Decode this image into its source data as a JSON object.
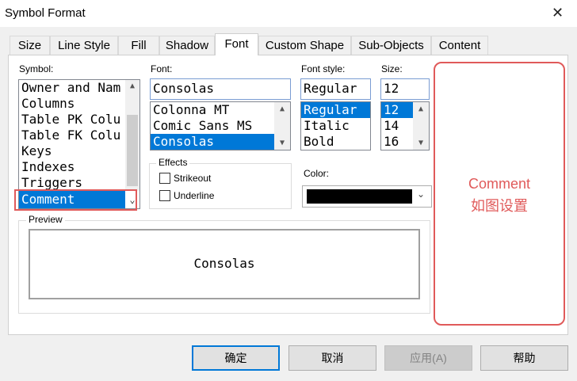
{
  "window": {
    "title": "Symbol Format",
    "close_glyph": "✕"
  },
  "tabs": [
    "Size",
    "Line Style",
    "Fill",
    "Shadow",
    "Font",
    "Custom Shape",
    "Sub-Objects",
    "Content"
  ],
  "symbol": {
    "label": "Symbol:",
    "items": [
      "Owner and Nam",
      "Columns",
      "Table PK Colu",
      "Table FK Colu",
      "Keys",
      "Indexes",
      "Triggers"
    ],
    "selected": "Comment"
  },
  "font": {
    "label": "Font:",
    "value": "Consolas",
    "items": [
      "Colonna MT",
      "Comic Sans MS",
      "Consolas"
    ]
  },
  "font_style": {
    "label": "Font style:",
    "value": "Regular",
    "items": [
      "Regular",
      "Italic",
      "Bold"
    ]
  },
  "size": {
    "label": "Size:",
    "value": "12",
    "items": [
      "12",
      "14",
      "16"
    ]
  },
  "effects": {
    "label": "Effects",
    "strikeout": "Strikeout",
    "underline": "Underline"
  },
  "color": {
    "label": "Color:",
    "value": "#000000"
  },
  "preview": {
    "label": "Preview",
    "text": "Consolas"
  },
  "annotation": {
    "line1": "Comment",
    "line2": "如图设置",
    "color": "#e05a5a"
  },
  "buttons": {
    "ok": "确定",
    "cancel": "取消",
    "apply": "应用(A)",
    "help": "帮助"
  },
  "colors": {
    "selection": "#0078d7",
    "focus_border": "#7a9cd3"
  }
}
